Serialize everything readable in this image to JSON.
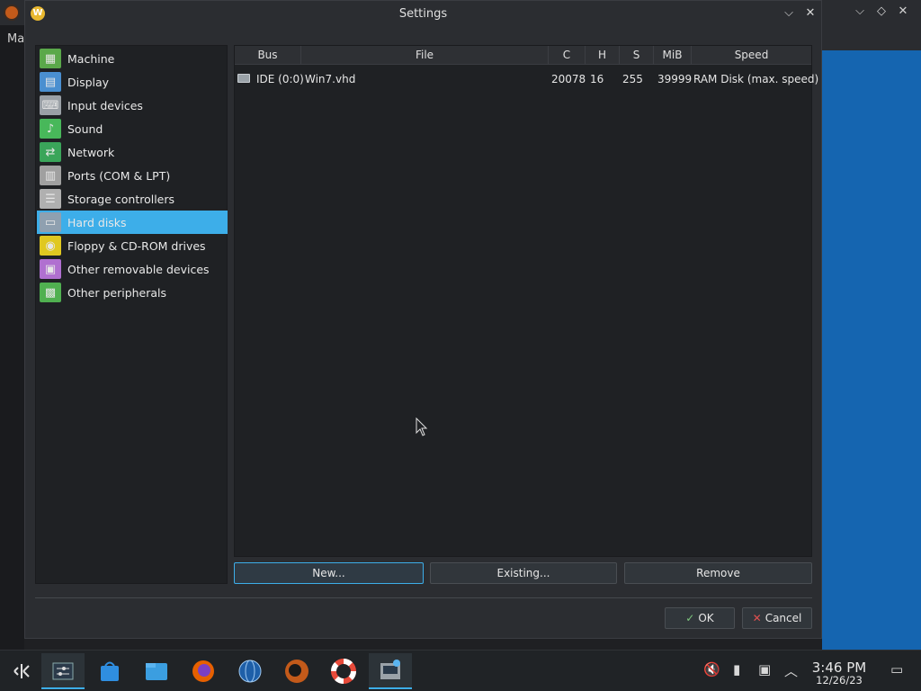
{
  "background": {
    "menu_text": "Ma"
  },
  "dialog": {
    "title": "Settings",
    "sidebar": [
      {
        "label": "Machine",
        "icon": "motherboard-icon",
        "color": "#5aa84a"
      },
      {
        "label": "Display",
        "icon": "display-card-icon",
        "color": "#4a8fd0"
      },
      {
        "label": "Input devices",
        "icon": "keyboard-icon",
        "color": "#9aa0a6"
      },
      {
        "label": "Sound",
        "icon": "speaker-icon",
        "color": "#48b85a"
      },
      {
        "label": "Network",
        "icon": "network-card-icon",
        "color": "#3aa55a"
      },
      {
        "label": "Ports (COM & LPT)",
        "icon": "port-icon",
        "color": "#a0a0a0"
      },
      {
        "label": "Storage controllers",
        "icon": "storage-controller-icon",
        "color": "#b0b0b0"
      },
      {
        "label": "Hard disks",
        "icon": "hard-disk-icon",
        "color": "#8fa0b0"
      },
      {
        "label": "Floppy & CD-ROM drives",
        "icon": "floppy-cd-icon",
        "color": "#e0c820"
      },
      {
        "label": "Other removable devices",
        "icon": "removable-device-icon",
        "color": "#b070d0"
      },
      {
        "label": "Other peripherals",
        "icon": "peripheral-chip-icon",
        "color": "#50b050"
      }
    ],
    "selected_index": 7,
    "table": {
      "columns": [
        "Bus",
        "File",
        "C",
        "H",
        "S",
        "MiB",
        "Speed"
      ],
      "rows": [
        {
          "bus": "IDE (0:0)",
          "file": "Win7.vhd",
          "c": "20078",
          "h": "16",
          "s": "255",
          "mib": "39999",
          "speed": "RAM Disk (max. speed)"
        }
      ]
    },
    "buttons": {
      "new": "New...",
      "existing": "Existing...",
      "remove": "Remove",
      "ok": "OK",
      "cancel": "Cancel"
    }
  },
  "taskbar": {
    "time": "3:46 PM",
    "date": "12/26/23"
  },
  "colors": {
    "accent": "#3daee9",
    "desktop": "#1565b0"
  }
}
